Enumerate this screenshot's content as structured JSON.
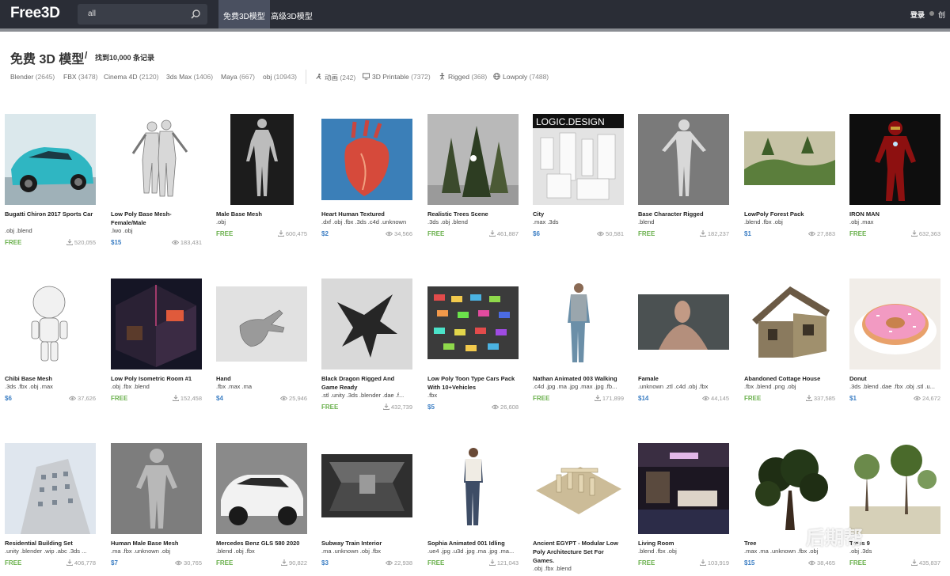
{
  "header": {
    "logo": "Free3D",
    "search_value": "all",
    "tabs": [
      "免费3D模型",
      "高级3D模型"
    ],
    "login": "登录",
    "create": "创"
  },
  "page": {
    "title": "免费 3D 模型",
    "separator": "/",
    "count": "找到10,000 条记录"
  },
  "filters": [
    {
      "label": "Blender",
      "count": "(2645)"
    },
    {
      "label": "FBX",
      "count": "(3478)"
    },
    {
      "label": "Cinema 4D",
      "count": "(2120)"
    },
    {
      "label": "3ds Max",
      "count": "(1406)"
    },
    {
      "label": "Maya",
      "count": "(667)"
    },
    {
      "label": "obj",
      "count": "(10943)"
    },
    {
      "label": "动画",
      "count": "(242)",
      "icon": "running-icon"
    },
    {
      "label": "3D Printable",
      "count": "(7372)",
      "icon": "monitor-icon"
    },
    {
      "label": "Rigged",
      "count": "(368)",
      "icon": "figure-icon"
    },
    {
      "label": "Lowpoly",
      "count": "(7488)",
      "icon": "globe-icon"
    }
  ],
  "models": [
    {
      "title": "Bugatti Chiron 2017 Sports Car",
      "formats": ".obj .blend",
      "price": "FREE",
      "stat": "520,055",
      "stat_icon": "download-icon",
      "thumb": "car-teal"
    },
    {
      "title": "Low Poly Base Mesh-Female/Male",
      "formats": ".lwo .obj",
      "price": "$15",
      "stat": "183,431",
      "stat_icon": "eye-icon",
      "thumb": "wire-bodies"
    },
    {
      "title": "Male Base Mesh",
      "formats": ".obj",
      "price": "FREE",
      "stat": "600,475",
      "stat_icon": "download-icon",
      "thumb": "male-dark"
    },
    {
      "title": "Heart Human Textured",
      "formats": ".dxf .obj .fbx .3ds .c4d .unknown",
      "price": "$2",
      "stat": "34,566",
      "stat_icon": "eye-icon",
      "thumb": "heart"
    },
    {
      "title": "Realistic Trees Scene",
      "formats": ".3ds .obj .blend",
      "price": "FREE",
      "stat": "461,887",
      "stat_icon": "download-icon",
      "thumb": "trees-grey"
    },
    {
      "title": "City",
      "formats": ".max .3ds",
      "price": "$6",
      "stat": "50,581",
      "stat_icon": "eye-icon",
      "thumb": "city",
      "thumb_text": "LOGIC.DESIGN"
    },
    {
      "title": "Base Character Rigged",
      "formats": ".blend",
      "price": "FREE",
      "stat": "182,237",
      "stat_icon": "download-icon",
      "thumb": "base-char"
    },
    {
      "title": "LowPoly Forest Pack",
      "formats": ".blend .fbx .obj",
      "price": "$1",
      "stat": "27,883",
      "stat_icon": "eye-icon",
      "thumb": "forest"
    },
    {
      "title": "IRON MAN",
      "formats": ".obj .max",
      "price": "FREE",
      "stat": "632,363",
      "stat_icon": "download-icon",
      "thumb": "ironman"
    },
    {
      "title": "Chibi Base Mesh",
      "formats": ".3ds .fbx .obj .max",
      "price": "$6",
      "stat": "37,626",
      "stat_icon": "eye-icon",
      "thumb": "chibi"
    },
    {
      "title": "Low Poly Isometric Room #1",
      "formats": ".obj .fbx .blend",
      "price": "FREE",
      "stat": "152,458",
      "stat_icon": "download-icon",
      "thumb": "room"
    },
    {
      "title": "Hand",
      "formats": ".fbx .max .ma",
      "price": "$4",
      "stat": "25,946",
      "stat_icon": "eye-icon",
      "thumb": "hand"
    },
    {
      "title": "Black Dragon Rigged And Game Ready",
      "formats": ".stl .unity .3ds .blender .dae .f...",
      "price": "FREE",
      "stat": "432,739",
      "stat_icon": "download-icon",
      "thumb": "dragon"
    },
    {
      "title": "Low Poly Toon Type Cars Pack With 10+Vehicles",
      "formats": ".fbx",
      "price": "$5",
      "stat": "26,608",
      "stat_icon": "eye-icon",
      "thumb": "cars"
    },
    {
      "title": "Nathan Animated 003 Walking",
      "formats": ".c4d .jpg .ma .jpg .max .jpg .fb...",
      "price": "FREE",
      "stat": "171,899",
      "stat_icon": "download-icon",
      "thumb": "nathan"
    },
    {
      "title": "Famale",
      "formats": ".unknown .ztl .c4d .obj .fbx",
      "price": "$14",
      "stat": "44,145",
      "stat_icon": "eye-icon",
      "thumb": "famale"
    },
    {
      "title": "Abandoned Cottage House",
      "formats": ".fbx .blend .png .obj",
      "price": "FREE",
      "stat": "337,585",
      "stat_icon": "download-icon",
      "thumb": "cottage"
    },
    {
      "title": "Donut",
      "formats": ".3ds .blend .dae .fbx .obj .stl .u...",
      "price": "$1",
      "stat": "24,672",
      "stat_icon": "eye-icon",
      "thumb": "donut"
    },
    {
      "title": "Residential Building Set",
      "formats": ".unity .blender .wip .abc .3ds ...",
      "price": "FREE",
      "stat": "406,778",
      "stat_icon": "download-icon",
      "thumb": "building"
    },
    {
      "title": "Human Male Base Mesh",
      "formats": ".ma .fbx .unknown .obj",
      "price": "$7",
      "stat": "30,765",
      "stat_icon": "eye-icon",
      "thumb": "human-male"
    },
    {
      "title": "Mercedes Benz GLS 580 2020",
      "formats": ".blend .obj .fbx",
      "price": "FREE",
      "stat": "90,822",
      "stat_icon": "download-icon",
      "thumb": "mercedes"
    },
    {
      "title": "Subway Train Interior",
      "formats": ".ma .unknown .obj .fbx",
      "price": "$3",
      "stat": "22,938",
      "stat_icon": "eye-icon",
      "thumb": "subway"
    },
    {
      "title": "Sophia Animated 001 Idling",
      "formats": ".ue4 .jpg .u3d .jpg .ma .jpg .ma...",
      "price": "FREE",
      "stat": "121,043",
      "stat_icon": "download-icon",
      "thumb": "sophia"
    },
    {
      "title": "Ancient EGYPT - Modular Low Poly Architecture Set For Games.",
      "formats": ".obj .fbx .blend",
      "price": "",
      "stat": "",
      "stat_icon": "",
      "thumb": "egypt"
    },
    {
      "title": "Living Room",
      "formats": ".blend .fbx .obj",
      "price": "FREE",
      "stat": "103,919",
      "stat_icon": "download-icon",
      "thumb": "living"
    },
    {
      "title": "Tree",
      "formats": ".max .ma .unknown .fbx .obj",
      "price": "$15",
      "stat": "38,465",
      "stat_icon": "eye-icon",
      "thumb": "tree"
    },
    {
      "title": "Trees 9",
      "formats": ".obj .3ds",
      "price": "FREE",
      "stat": "435,837",
      "stat_icon": "download-icon",
      "thumb": "trees9"
    }
  ],
  "watermark": "后期帮",
  "colors": {
    "free": "#6ab04c",
    "paid": "#3d7fc4",
    "topbar": "#2a2d36"
  }
}
